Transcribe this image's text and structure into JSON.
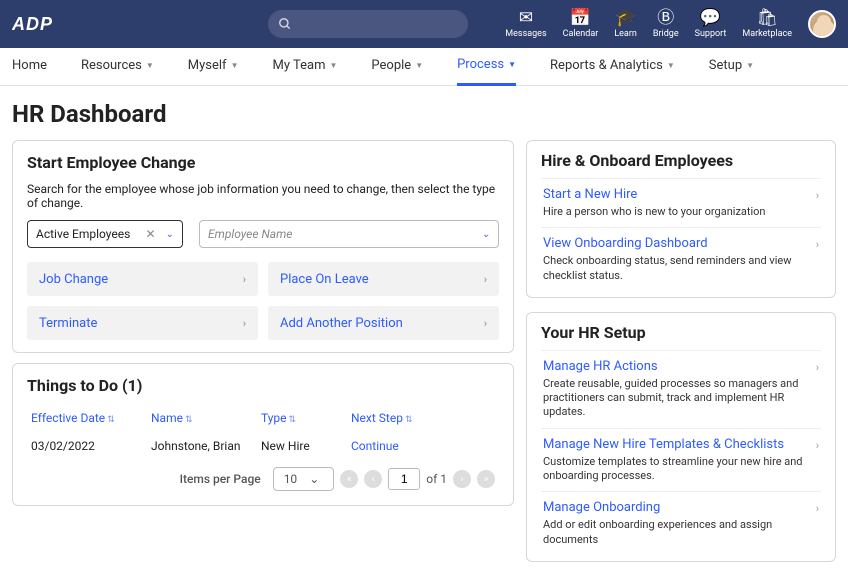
{
  "brand": "ADP",
  "search": {
    "placeholder": ""
  },
  "topnav": [
    {
      "id": "messages",
      "label": "Messages",
      "icon": "envelope"
    },
    {
      "id": "calendar",
      "label": "Calendar",
      "icon": "calendar"
    },
    {
      "id": "learn",
      "label": "Learn",
      "icon": "grad-cap"
    },
    {
      "id": "bridge",
      "label": "Bridge",
      "icon": "circle-b"
    },
    {
      "id": "support",
      "label": "Support",
      "icon": "chat"
    },
    {
      "id": "marketplace",
      "label": "Marketplace",
      "icon": "bag"
    }
  ],
  "mainnav": {
    "items": [
      "Home",
      "Resources",
      "Myself",
      "My Team",
      "People",
      "Process",
      "Reports & Analytics",
      "Setup"
    ],
    "active_index": 5
  },
  "page_title": "HR Dashboard",
  "start_change": {
    "title": "Start Employee Change",
    "instruction": "Search for the employee whose job information you need to change, then select the type of change.",
    "filter_value": "Active Employees",
    "employee_placeholder": "Employee Name",
    "actions": [
      "Job Change",
      "Place On Leave",
      "Terminate",
      "Add Another Position"
    ]
  },
  "todo": {
    "title": "Things to Do (1)",
    "columns": [
      "Effective Date",
      "Name",
      "Type",
      "Next Step"
    ],
    "rows": [
      {
        "date": "03/02/2022",
        "name": "Johnstone, Brian",
        "type": "New Hire",
        "next": "Continue"
      }
    ],
    "pager": {
      "items_per_page_label": "Items per Page",
      "items_per_page": "10",
      "current_page": "1",
      "of_label": "of 1"
    }
  },
  "hire_onboard": {
    "title": "Hire & Onboard Employees",
    "items": [
      {
        "link": "Start a New Hire",
        "desc": "Hire a person who is new to your organization"
      },
      {
        "link": "View Onboarding Dashboard",
        "desc": "Check onboarding status, send reminders and view checklist status."
      }
    ]
  },
  "hr_setup": {
    "title": "Your HR Setup",
    "items": [
      {
        "link": "Manage HR Actions",
        "desc": "Create reusable, guided processes so managers and practitioners can submit, track and implement HR updates."
      },
      {
        "link": "Manage New Hire Templates & Checklists",
        "desc": "Customize templates to streamline your new hire and onboarding processes."
      },
      {
        "link": "Manage Onboarding",
        "desc": "Add or edit onboarding experiences and assign documents"
      }
    ]
  }
}
